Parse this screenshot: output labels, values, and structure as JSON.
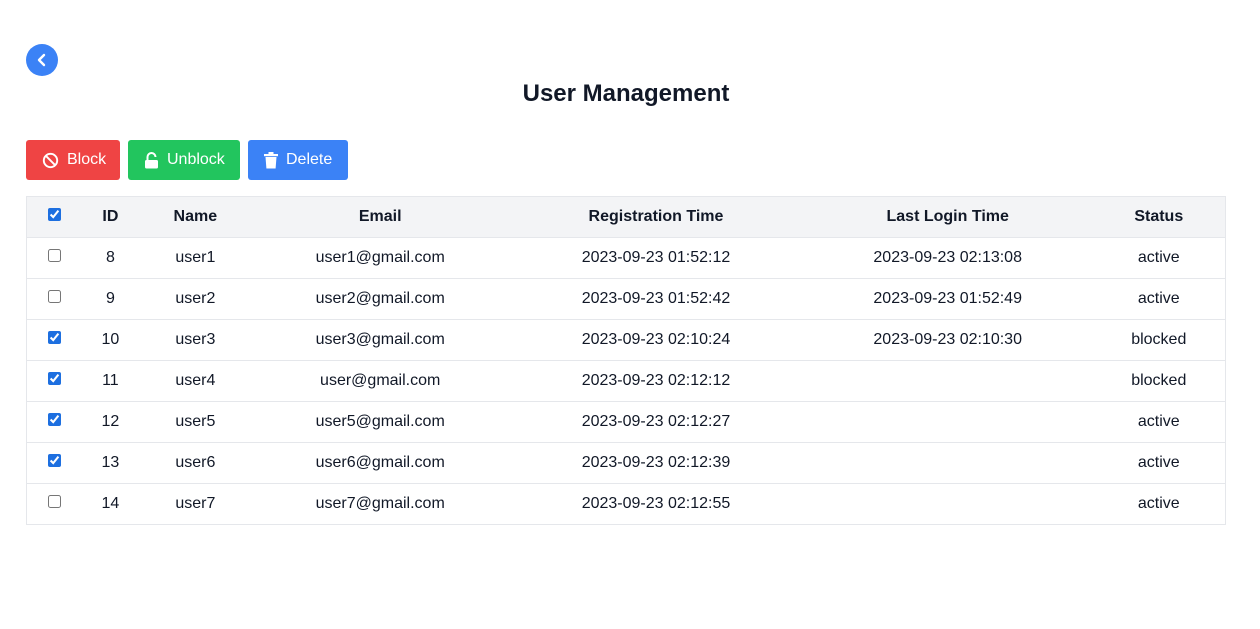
{
  "page": {
    "title": "User Management"
  },
  "toolbar": {
    "block_label": "Block",
    "unblock_label": "Unblock",
    "delete_label": "Delete"
  },
  "table": {
    "select_all_checked": true,
    "columns": [
      "ID",
      "Name",
      "Email",
      "Registration Time",
      "Last Login Time",
      "Status"
    ],
    "rows": [
      {
        "checked": false,
        "id": "8",
        "name": "user1",
        "email": "user1@gmail.com",
        "registered": "2023-09-23 01:52:12",
        "last_login": "2023-09-23 02:13:08",
        "status": "active"
      },
      {
        "checked": false,
        "id": "9",
        "name": "user2",
        "email": "user2@gmail.com",
        "registered": "2023-09-23 01:52:42",
        "last_login": "2023-09-23 01:52:49",
        "status": "active"
      },
      {
        "checked": true,
        "id": "10",
        "name": "user3",
        "email": "user3@gmail.com",
        "registered": "2023-09-23 02:10:24",
        "last_login": "2023-09-23 02:10:30",
        "status": "blocked"
      },
      {
        "checked": true,
        "id": "11",
        "name": "user4",
        "email": "user@gmail.com",
        "registered": "2023-09-23 02:12:12",
        "last_login": "",
        "status": "blocked"
      },
      {
        "checked": true,
        "id": "12",
        "name": "user5",
        "email": "user5@gmail.com",
        "registered": "2023-09-23 02:12:27",
        "last_login": "",
        "status": "active"
      },
      {
        "checked": true,
        "id": "13",
        "name": "user6",
        "email": "user6@gmail.com",
        "registered": "2023-09-23 02:12:39",
        "last_login": "",
        "status": "active"
      },
      {
        "checked": false,
        "id": "14",
        "name": "user7",
        "email": "user7@gmail.com",
        "registered": "2023-09-23 02:12:55",
        "last_login": "",
        "status": "active"
      }
    ]
  },
  "icons": {
    "back": "chevron-left-icon",
    "block": "ban-icon",
    "unblock": "unlock-icon",
    "delete": "trash-icon"
  },
  "colors": {
    "block": "#ef4444",
    "unblock": "#22c55e",
    "delete": "#3b82f6",
    "back": "#3b82f6",
    "header_bg": "#f3f4f6"
  }
}
